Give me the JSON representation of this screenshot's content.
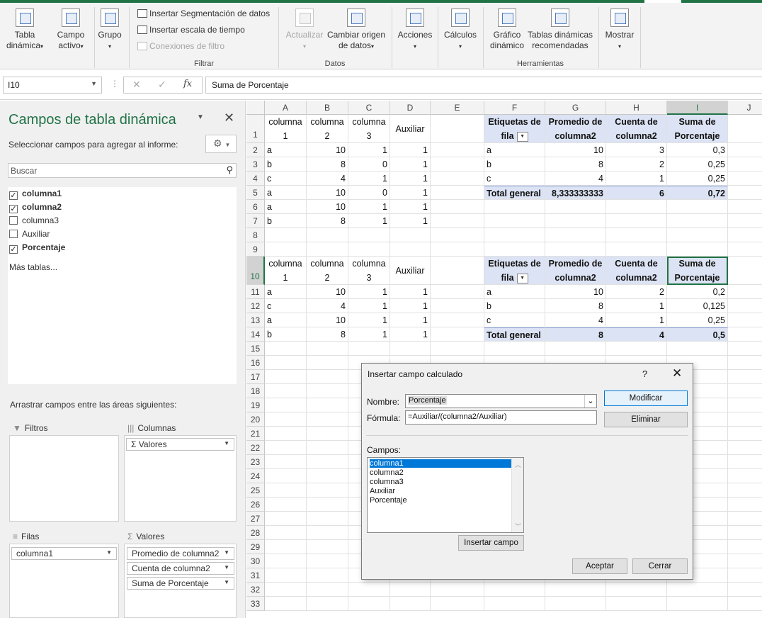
{
  "ribbon": {
    "btn_tabla": [
      "Tabla",
      "dinámica"
    ],
    "btn_campo": [
      "Campo",
      "activo"
    ],
    "btn_grupo": "Grupo",
    "filtrar_items": [
      "Insertar Segmentación de datos",
      "Insertar escala de tiempo",
      "Conexiones de filtro"
    ],
    "btn_actualizar": "Actualizar",
    "btn_cambiar": [
      "Cambiar origen",
      "de datos"
    ],
    "btn_acciones": "Acciones",
    "btn_calculos": "Cálculos",
    "btn_grafico": [
      "Gráfico",
      "dinámico"
    ],
    "btn_tablas_rec": [
      "Tablas dinámicas",
      "recomendadas"
    ],
    "btn_mostrar": "Mostrar",
    "group_filtrar": "Filtrar",
    "group_datos": "Datos",
    "group_herramientas": "Herramientas"
  },
  "formula_bar": {
    "name_box": "I10",
    "fx": "fx",
    "content": "Suma de Porcentaje"
  },
  "pane": {
    "title": "Campos de tabla dinámica",
    "subtitle": "Seleccionar campos para agregar al informe:",
    "search_placeholder": "Buscar",
    "fields": [
      {
        "label": "columna1",
        "checked": true
      },
      {
        "label": "columna2",
        "checked": true
      },
      {
        "label": "columna3",
        "checked": false
      },
      {
        "label": "Auxiliar",
        "checked": false
      },
      {
        "label": "Porcentaje",
        "checked": true
      }
    ],
    "more_tables": "Más tablas...",
    "drag_hint": "Arrastrar campos entre las áreas siguientes:",
    "area_filtros": "Filtros",
    "area_columnas": "Columnas",
    "area_filas": "Filas",
    "area_valores": "Valores",
    "columnas_chips": [
      "Valores"
    ],
    "filas_chips": [
      "columna1"
    ],
    "valores_chips": [
      "Promedio de columna2",
      "Cuenta de columna2",
      "Suma de Porcentaje"
    ]
  },
  "grid": {
    "columns": [
      "A",
      "B",
      "C",
      "D",
      "E",
      "F",
      "G",
      "H",
      "I",
      "J"
    ],
    "rows": [
      "1",
      "2",
      "3",
      "4",
      "5",
      "6",
      "7",
      "8",
      "9",
      "10",
      "11",
      "12",
      "13",
      "14",
      "15",
      "16",
      "17",
      "18",
      "19",
      "20",
      "21",
      "22",
      "23",
      "24",
      "25",
      "26",
      "27",
      "28",
      "29",
      "30",
      "31",
      "32",
      "33"
    ],
    "source_headers": [
      [
        "columna",
        "1"
      ],
      [
        "columna",
        "2"
      ],
      [
        "columna",
        "3"
      ],
      [
        "Auxiliar"
      ]
    ],
    "table1_rows": [
      [
        "a",
        "10",
        "1",
        "1"
      ],
      [
        "b",
        "8",
        "0",
        "1"
      ],
      [
        "c",
        "4",
        "1",
        "1"
      ],
      [
        "a",
        "10",
        "0",
        "1"
      ],
      [
        "a",
        "10",
        "1",
        "1"
      ],
      [
        "b",
        "8",
        "1",
        "1"
      ]
    ],
    "table2_rows": [
      [
        "a",
        "10",
        "1",
        "1"
      ],
      [
        "c",
        "4",
        "1",
        "1"
      ],
      [
        "a",
        "10",
        "1",
        "1"
      ],
      [
        "b",
        "8",
        "1",
        "1"
      ]
    ],
    "pivot_headers": [
      [
        "Etiquetas de",
        "fila"
      ],
      [
        "Promedio de",
        "columna2"
      ],
      [
        "Cuenta de",
        "columna2"
      ],
      [
        "Suma de",
        "Porcentaje"
      ]
    ],
    "pivot1_rows": [
      [
        "a",
        "10",
        "3",
        "0,3"
      ],
      [
        "b",
        "8",
        "2",
        "0,25"
      ],
      [
        "c",
        "4",
        "1",
        "0,25"
      ]
    ],
    "pivot1_total": [
      "Total general",
      "8,333333333",
      "6",
      "0,72"
    ],
    "pivot2_rows": [
      [
        "a",
        "10",
        "2",
        "0,2"
      ],
      [
        "b",
        "8",
        "1",
        "0,125"
      ],
      [
        "c",
        "4",
        "1",
        "0,25"
      ]
    ],
    "pivot2_total": [
      "Total general",
      "8",
      "4",
      "0,5"
    ]
  },
  "dialog": {
    "title": "Insertar campo calculado",
    "help": "?",
    "close": "✕",
    "nombre_label": "Nombre:",
    "nombre_value": "Porcentaje",
    "formula_label": "Fórmula:",
    "formula_value": "=Auxiliar/(columna2/Auxiliar)",
    "btn_modificar": "Modificar",
    "btn_eliminar": "Eliminar",
    "campos_label": "Campos:",
    "campos": [
      "columna1",
      "columna2",
      "columna3",
      "Auxiliar",
      "Porcentaje"
    ],
    "btn_insertar_campo": "Insertar campo",
    "btn_aceptar": "Aceptar",
    "btn_cerrar": "Cerrar"
  }
}
